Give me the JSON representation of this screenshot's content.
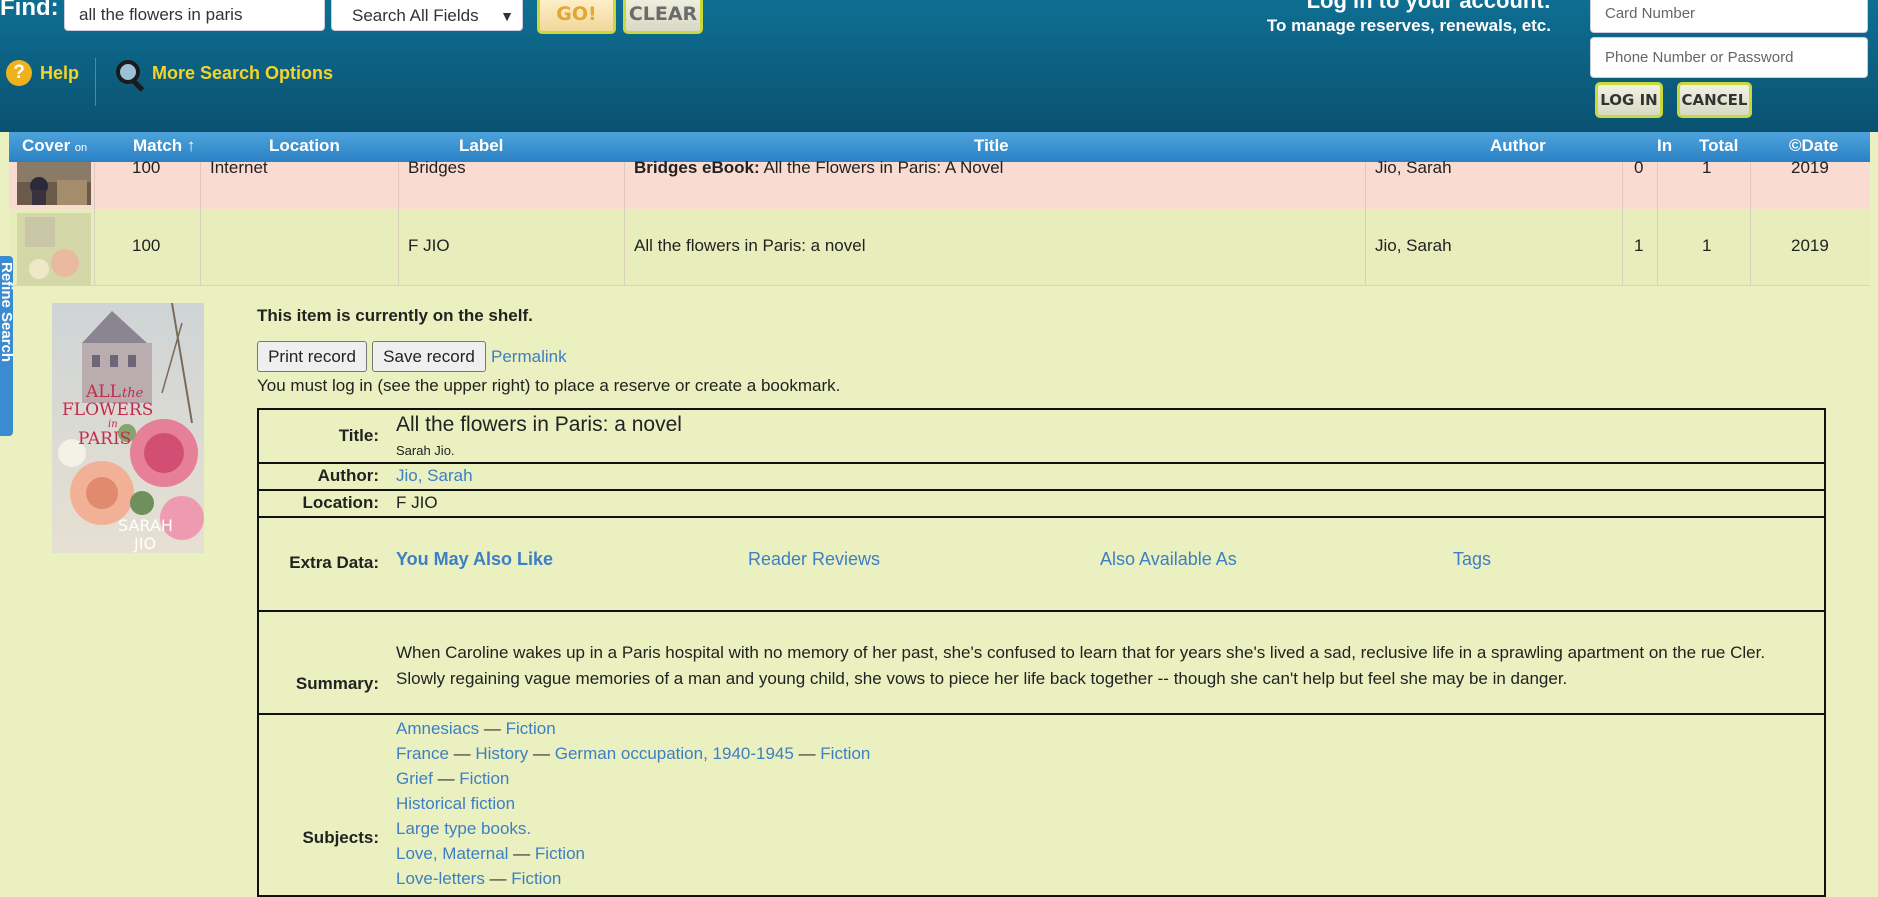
{
  "header": {
    "find_label": "Find:",
    "search_value": "all the flowers in paris",
    "field_select": "Search All Fields",
    "go_label": "GO!",
    "clear_label": "CLEAR",
    "help_label": "Help",
    "more_options_label": "More Search Options",
    "login_heading": "Log in to your account:",
    "login_subtitle": "To manage reserves, renewals, etc.",
    "card_placeholder": "Card Number",
    "phone_placeholder": "Phone Number or Password",
    "login_label": "LOG IN",
    "cancel_label": "CANCEL"
  },
  "refine_tab": "Refine Search",
  "results": {
    "columns": {
      "cover": "Cover",
      "cover_on": "on",
      "match": "Match",
      "match_arrow": "↑",
      "location": "Location",
      "label": "Label",
      "title": "Title",
      "author": "Author",
      "in": "In",
      "total": "Total",
      "date": "©Date"
    },
    "rows": [
      {
        "match": "100",
        "location": "Internet",
        "label": "Bridges",
        "title_prefix": "Bridges eBook:",
        "title": "All the Flowers in Paris: A Novel",
        "author": "Jio, Sarah",
        "in": "0",
        "total": "1",
        "date": "2019"
      },
      {
        "match": "100",
        "location": "",
        "label": "F JIO",
        "title_prefix": "",
        "title": "All the flowers in Paris: a novel",
        "author": "Jio, Sarah",
        "in": "1",
        "total": "1",
        "date": "2019"
      }
    ]
  },
  "cover_art": {
    "line1": "ALL",
    "line2": "the",
    "line3": "FLOWERS",
    "line4": "in",
    "line5": "PARIS",
    "author1": "SARAH",
    "author2": "JIO"
  },
  "detail": {
    "shelf_status": "This item is currently on the shelf.",
    "print_label": "Print record",
    "save_label": "Save record",
    "permalink_label": "Permalink",
    "login_note": "You must log in (see the upper right) to place a reserve or create a bookmark.",
    "labels": {
      "title": "Title:",
      "author": "Author:",
      "location": "Location:",
      "extra": "Extra Data:",
      "summary": "Summary:",
      "subjects": "Subjects:"
    },
    "title": "All the flowers in Paris: a novel",
    "statement": "Sarah Jio.",
    "author": "Jio, Sarah",
    "location": "F JIO",
    "extra_links": [
      "You May Also Like",
      "Reader Reviews",
      "Also Available As",
      "Tags"
    ],
    "summary_line1": "When Caroline wakes up in a Paris hospital with no memory of her past, she's confused to learn that for years she's lived a sad, reclusive life in a sprawling apartment on the rue Cler.",
    "summary_line2": "Slowly regaining vague memories of a man and young child, she vows to piece her life back together -- though she can't help but feel she may be in danger.",
    "subjects": [
      [
        "Amnesiacs",
        "Fiction"
      ],
      [
        "France",
        "History",
        "German occupation, 1940-1945",
        "Fiction"
      ],
      [
        "Grief",
        "Fiction"
      ],
      [
        "Historical fiction"
      ],
      [
        "Large type books."
      ],
      [
        "Love, Maternal",
        "Fiction"
      ],
      [
        "Love-letters",
        "Fiction"
      ]
    ],
    "subject_separator": "—"
  },
  "colors": {
    "header": "#0e6f93",
    "accent_yellow": "#f3d42a",
    "link": "#3d7fc4",
    "row_internet": "#fadbd2",
    "row_local": "#e8edbc",
    "page_bg": "#eaf0bf"
  }
}
